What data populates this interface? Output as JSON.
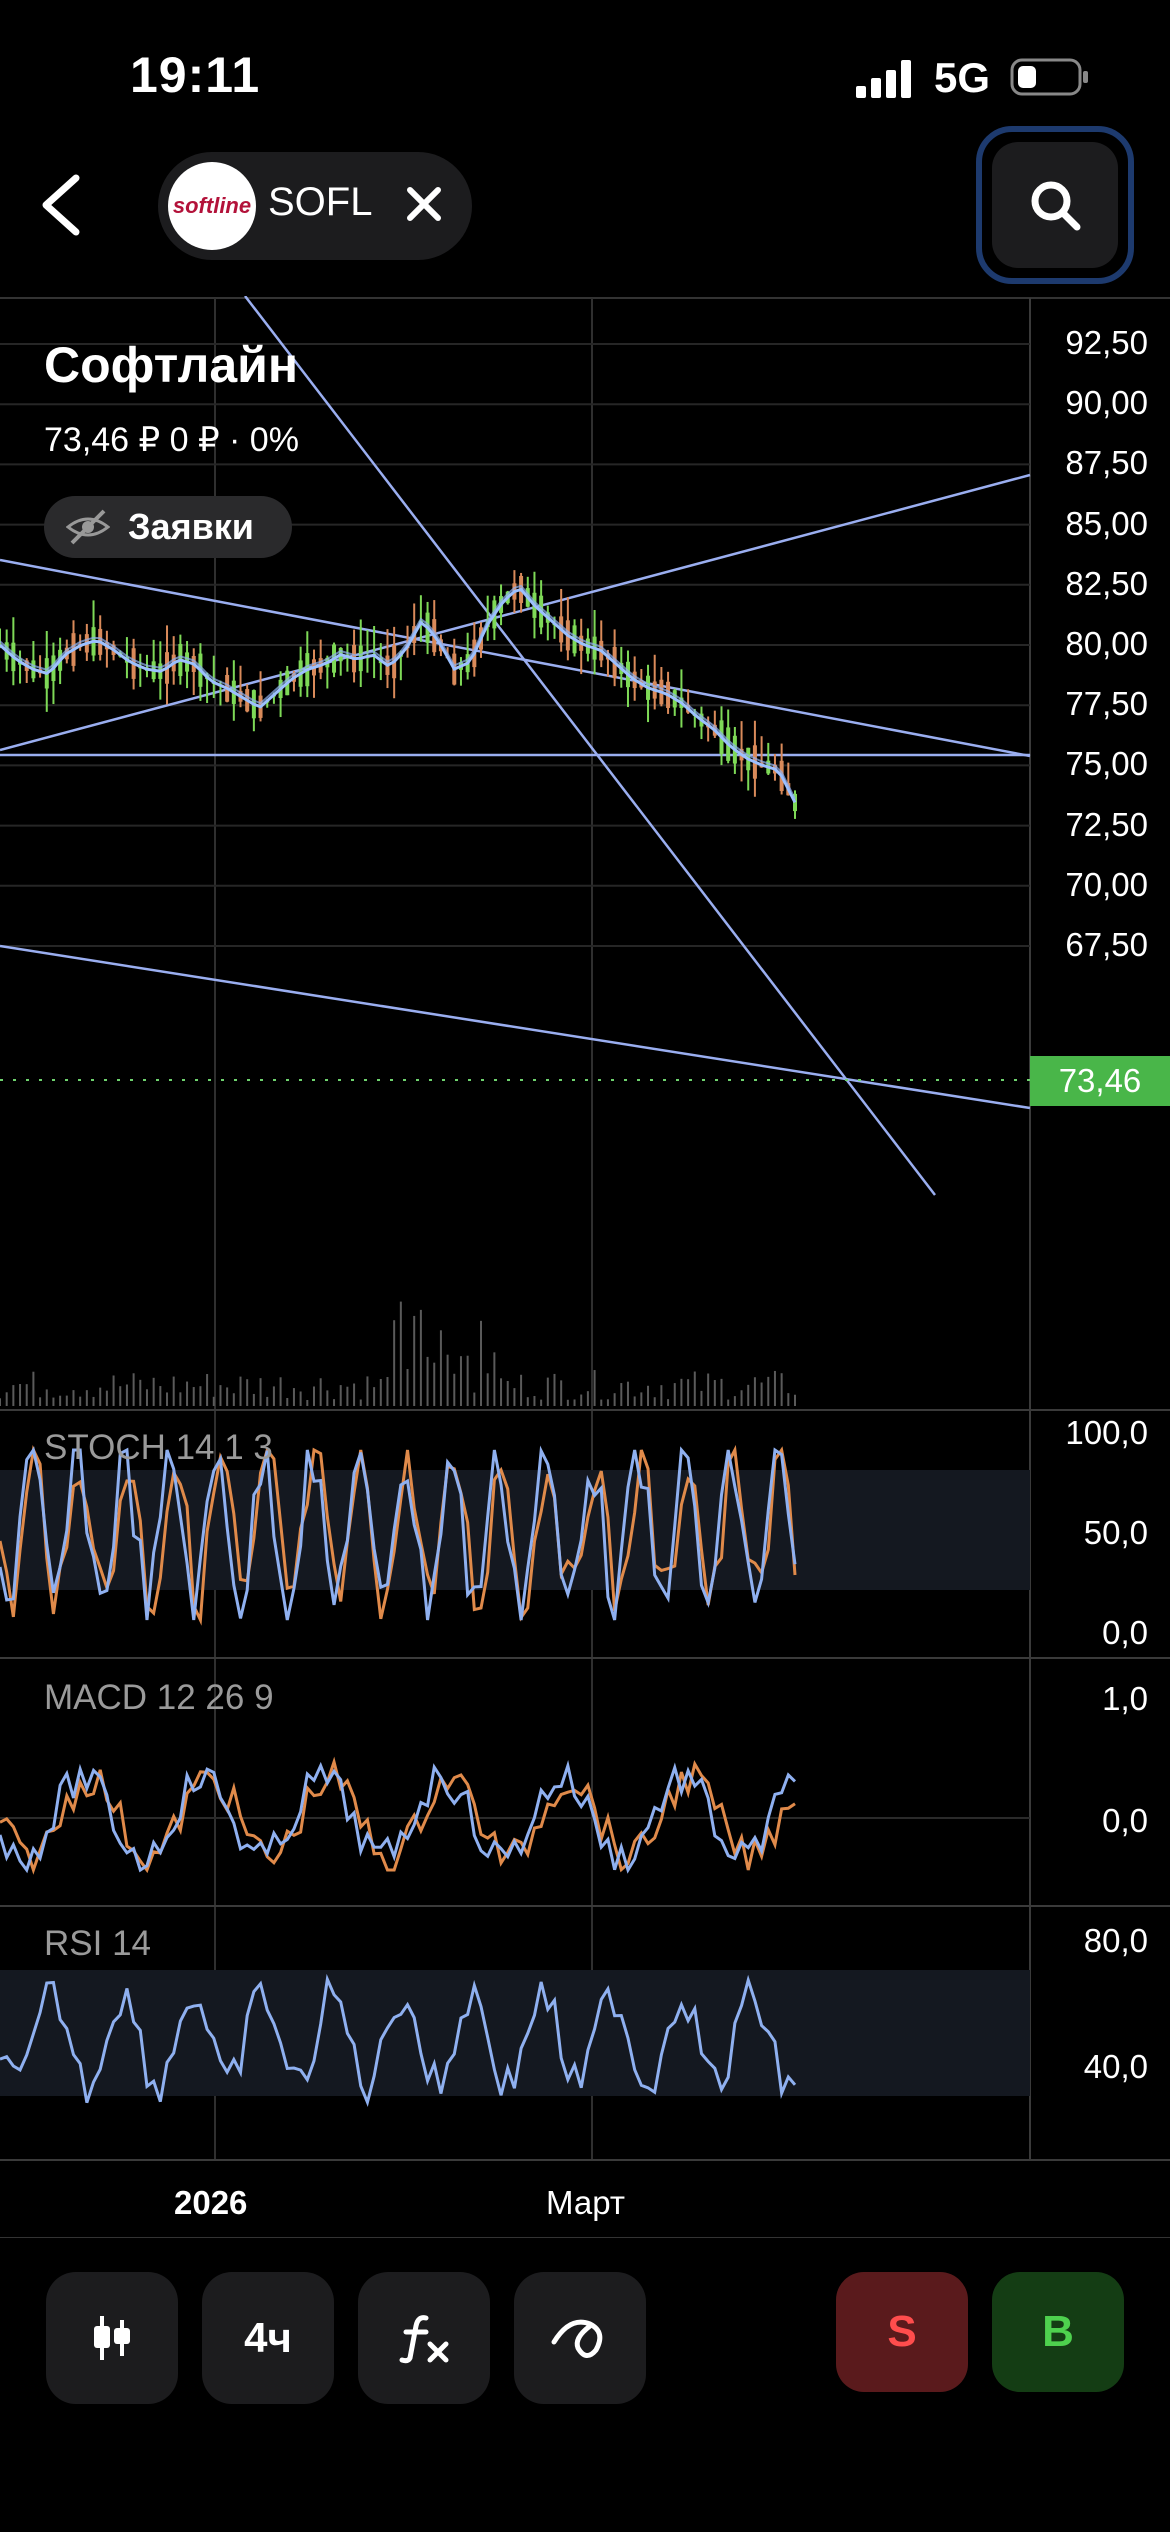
{
  "status_bar": {
    "time": "19:11",
    "network": "5G"
  },
  "header": {
    "ticker": "SOFL",
    "logo_text": "softline"
  },
  "instrument": {
    "name": "Софтлайн",
    "price_line": "73,46 ₽   0 ₽ · 0%",
    "orders_label": "Заявки"
  },
  "colors": {
    "trend_line": "#9aaef0",
    "up": "#7ed957",
    "down": "#d98a5a",
    "ma": "#8fb0f0",
    "current_price_bg": "#49b649",
    "sell_bg": "#5a1a1c",
    "buy_bg": "#143d14"
  },
  "chart_data": {
    "type": "line",
    "y_ticks": [
      "92,50",
      "90,00",
      "87,50",
      "85,00",
      "82,50",
      "80,00",
      "77,50",
      "75,00",
      "72,50",
      "70,00",
      "67,50"
    ],
    "current_price": "73,46",
    "x_labels": [
      "2026",
      "Март"
    ],
    "price_path": [
      80.0,
      79.4,
      79.0,
      78.8,
      79.6,
      80.0,
      80.2,
      79.8,
      79.3,
      79.0,
      78.9,
      79.4,
      79.2,
      78.5,
      78.2,
      77.8,
      77.4,
      78.0,
      78.6,
      79.0,
      79.2,
      79.6,
      79.4,
      79.6,
      79.1,
      79.8,
      81.0,
      80.2,
      79.0,
      79.3,
      80.8,
      81.8,
      82.4,
      81.6,
      81.0,
      80.4,
      80.0,
      79.8,
      79.2,
      78.6,
      78.2,
      78.0,
      77.6,
      77.0,
      76.5,
      75.8,
      75.3,
      75.0,
      74.8,
      73.46
    ],
    "indicators": [
      {
        "label": "STOCH 14 1 3",
        "ticks": [
          "100,0",
          "50,0",
          "0,0"
        ]
      },
      {
        "label": "MACD 12 26 9",
        "ticks": [
          "1,0",
          "0,0"
        ]
      },
      {
        "label": "RSI 14",
        "ticks": [
          "80,0",
          "40,0"
        ]
      }
    ]
  },
  "toolbar": {
    "interval_label": "4ч",
    "sell_label": "S",
    "buy_label": "B"
  }
}
